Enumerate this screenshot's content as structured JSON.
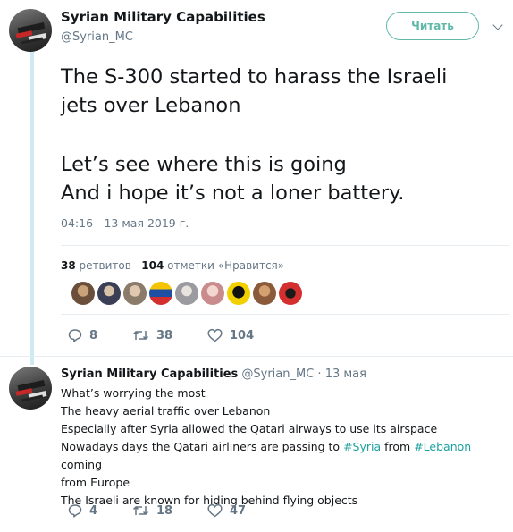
{
  "tweet": {
    "author_name": "Syrian Military Capabilities",
    "author_handle": "@Syrian_MC",
    "follow_button": "Читать",
    "text_lines": [
      "The S-300 started to harass the Israeli",
      "jets over Lebanon",
      "Let’s see where this is going",
      "And i hope it’s not a loner battery."
    ],
    "timestamp": "04:16 - 13 мая 2019 г.",
    "retweets_count": "38",
    "retweets_label": "ретвитов",
    "likes_count": "104",
    "likes_label": "отметки «Нравится»",
    "actions": {
      "replies": "8",
      "retweets": "38",
      "likes": "104"
    },
    "liker_avatars": [
      {
        "icon": "person-avatar-1",
        "color": "#6b4f3a"
      },
      {
        "icon": "person-avatar-2",
        "color": "#3a3f55"
      },
      {
        "icon": "person-avatar-3",
        "color": "#8a7b6a"
      },
      {
        "icon": "venezuela-flag-avatar",
        "color": "#f5c400"
      },
      {
        "icon": "person-avatar-5",
        "color": "#9a9aa0"
      },
      {
        "icon": "person-avatar-6",
        "color": "#c98b8b"
      },
      {
        "icon": "mask-avatar",
        "color": "#f2d000"
      },
      {
        "icon": "person-avatar-8",
        "color": "#8a5a3a"
      },
      {
        "icon": "red-logo-avatar",
        "color": "#d32f2f"
      }
    ]
  },
  "reply": {
    "author_name": "Syrian Military Capabilities",
    "author_handle": "@Syrian_MC",
    "date": "13 мая",
    "lines": [
      "What’s worrying the most",
      "The heavy aerial traffic over Lebanon",
      "Especially after Syria allowed the Qatari airways to use its airspace"
    ],
    "line4_before": "Nowadays days the Qatari airliners are passing to ",
    "hashtag_syria": "#Syria",
    "line4_middle": " from ",
    "hashtag_lebanon": "#Lebanon",
    "line4_after": " coming",
    "line5": "from Europe",
    "line6": "The Israeli are known for hiding behind flying objects",
    "actions": {
      "replies": "4",
      "retweets": "18",
      "likes": "47"
    }
  },
  "colors": {
    "accent": "#5fb8a8",
    "hashtag": "#1da1a0",
    "muted": "#657786",
    "thread_line": "#cfe9f0"
  }
}
